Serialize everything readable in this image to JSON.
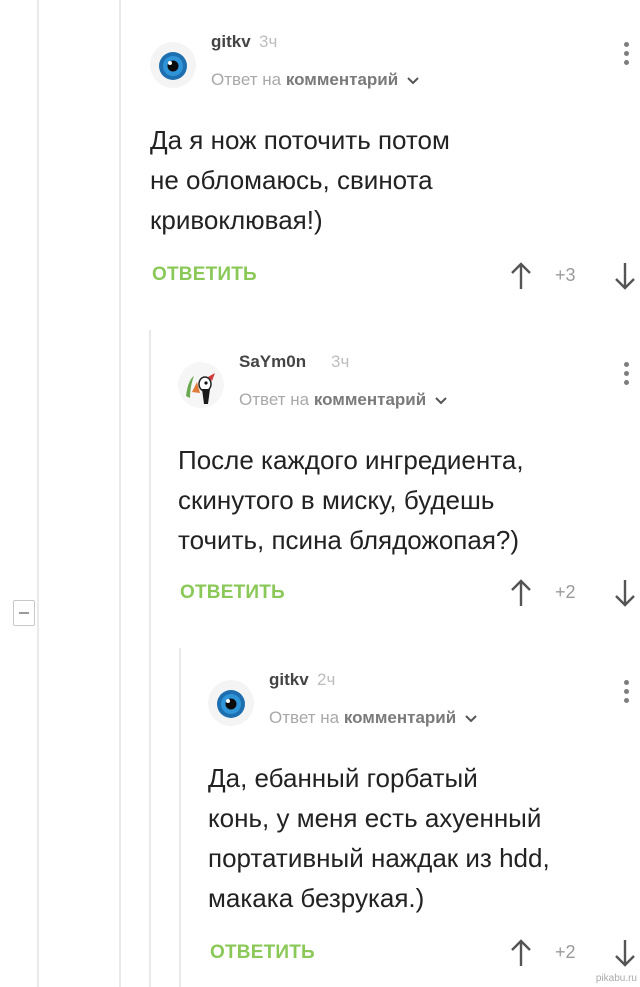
{
  "comments": [
    {
      "author": "gitkv",
      "time": "3ч",
      "reply_prefix": "Ответ на",
      "reply_target": "комментарий",
      "text_lines": [
        "Да я нож поточить потом",
        "не обломаюсь, свинота",
        "кривоклювая!)"
      ],
      "reply_label": "ОТВЕТИТЬ",
      "score": "+3",
      "avatar": "eye-avatar"
    },
    {
      "author": "SaYm0n",
      "time": "3ч",
      "reply_prefix": "Ответ на",
      "reply_target": "комментарий",
      "text_lines": [
        "После каждого ингредиента,",
        "скинутого в миску, будешь",
        "точить, псина блядожопая?)"
      ],
      "reply_label": "ОТВЕТИТЬ",
      "score": "+2",
      "avatar": "cartoon-avatar"
    },
    {
      "author": "gitkv",
      "time": "2ч",
      "reply_prefix": "Ответ на",
      "reply_target": "комментарий",
      "text_lines": [
        "Да, ебанный горбатый",
        "конь, у меня есть ахуенный",
        "портативный наждак из hdd,",
        "макака безрукая.)"
      ],
      "reply_label": "ОТВЕТИТЬ",
      "score": "+2",
      "avatar": "eye-avatar"
    }
  ],
  "watermark": "pikabu.ru",
  "colors": {
    "reply_green": "#8ac858",
    "thread_line": "#e9e9e9"
  }
}
